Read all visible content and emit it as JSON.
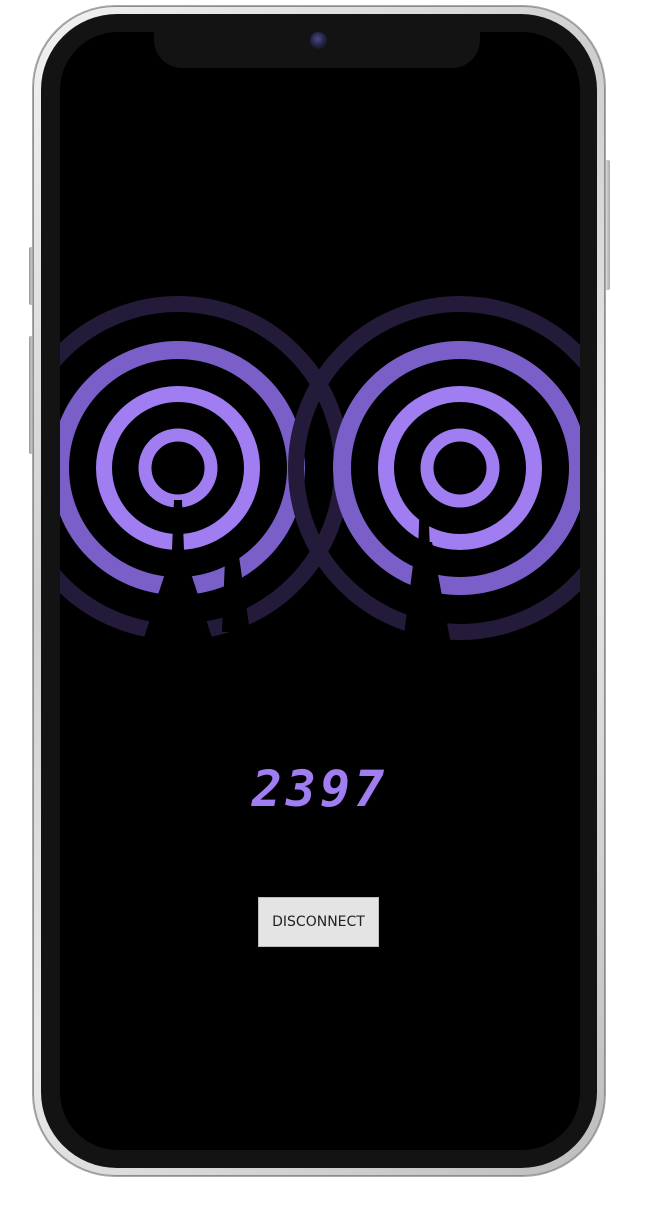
{
  "pairing": {
    "code": "2397"
  },
  "actions": {
    "disconnect_label": "DISCONNECT"
  },
  "colors": {
    "accent": "#a07ef2",
    "accent_mid": "#7a5fc9",
    "accent_faint": "#241b3a",
    "screen_bg": "#000000",
    "button_bg": "#e4e4e4"
  },
  "icons": [
    "signal-rings-icon",
    "signal-rings-icon"
  ]
}
